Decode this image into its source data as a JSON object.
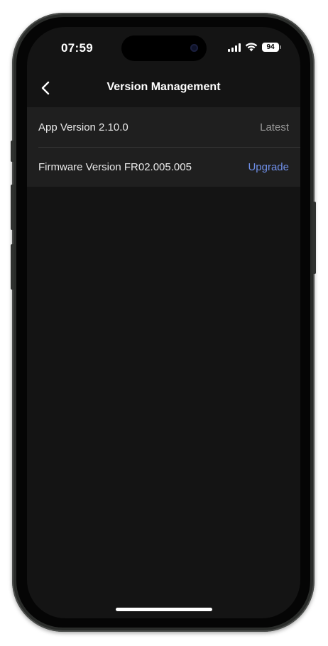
{
  "status_bar": {
    "time": "07:59",
    "battery": "94"
  },
  "nav": {
    "title": "Version Management"
  },
  "rows": [
    {
      "label": "App Version 2.10.0",
      "value": "Latest"
    },
    {
      "label": "Firmware Version FR02.005.005",
      "action": "Upgrade"
    }
  ],
  "colors": {
    "background": "#141414",
    "row_background": "#1f1f1f",
    "accent": "#6f8fe8"
  },
  "icons": {
    "back": "chevron-left-icon",
    "signal": "cellular-signal-icon",
    "wifi": "wifi-icon",
    "battery": "battery-icon"
  }
}
